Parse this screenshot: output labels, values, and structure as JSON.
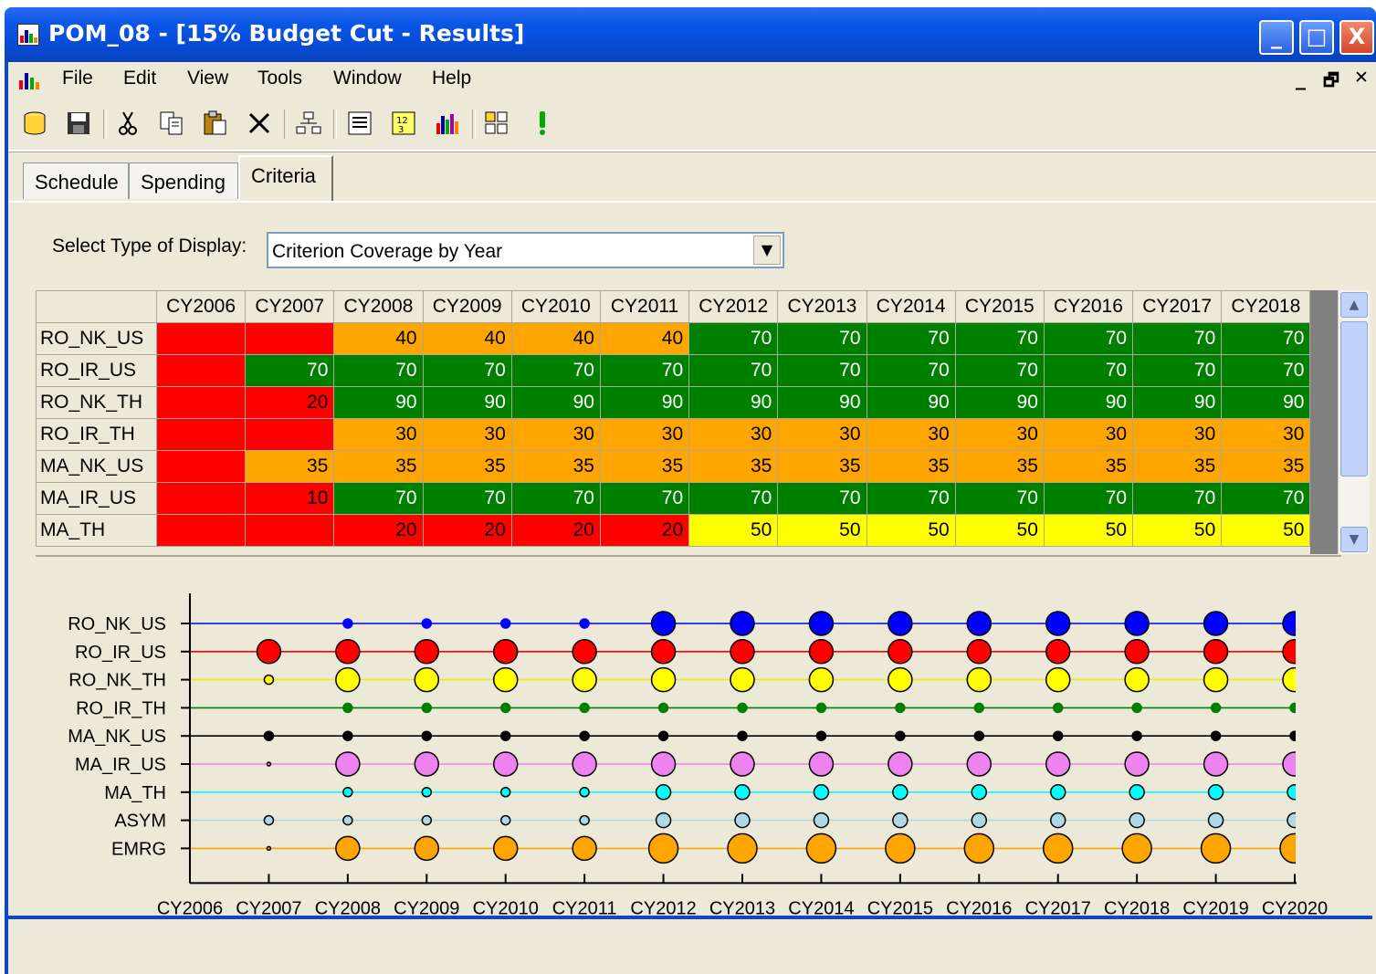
{
  "window": {
    "title": "POM_08 - [15% Budget Cut - Results]",
    "buttons": {
      "minimize": "_",
      "maximize": "□",
      "close": "X"
    }
  },
  "menu": {
    "items": [
      "File",
      "Edit",
      "View",
      "Tools",
      "Window",
      "Help"
    ],
    "mdi": {
      "minimize": "_",
      "restore": "🗗",
      "close": "✕"
    }
  },
  "toolbar": {
    "icons": [
      "database-icon",
      "save-icon",
      "cut-icon",
      "copy-icon",
      "paste-icon",
      "delete-icon",
      "hierarchy-icon",
      "list-icon",
      "table-numbers-icon",
      "bar-chart-icon",
      "layout-icon",
      "exclamation-icon"
    ]
  },
  "tabs": [
    {
      "label": "Schedule",
      "active": false
    },
    {
      "label": "Spending",
      "active": false
    },
    {
      "label": "Criteria",
      "active": true
    }
  ],
  "display_select": {
    "label": "Select Type of Display:",
    "value": "Criterion Coverage by Year"
  },
  "table": {
    "columns": [
      "",
      "CY2006",
      "CY2007",
      "CY2008",
      "CY2009",
      "CY2010",
      "CY2011",
      "CY2012",
      "CY2013",
      "CY2014",
      "CY2015",
      "CY2016",
      "CY2017",
      "CY2018"
    ],
    "rows": [
      {
        "name": "RO_NK_US",
        "values": [
          "",
          "",
          "40",
          "40",
          "40",
          "40",
          "70",
          "70",
          "70",
          "70",
          "70",
          "70",
          "70"
        ]
      },
      {
        "name": "RO_IR_US",
        "values": [
          "",
          "70",
          "70",
          "70",
          "70",
          "70",
          "70",
          "70",
          "70",
          "70",
          "70",
          "70",
          "70"
        ]
      },
      {
        "name": "RO_NK_TH",
        "values": [
          "",
          "20",
          "90",
          "90",
          "90",
          "90",
          "90",
          "90",
          "90",
          "90",
          "90",
          "90",
          "90"
        ]
      },
      {
        "name": "RO_IR_TH",
        "values": [
          "",
          "",
          "30",
          "30",
          "30",
          "30",
          "30",
          "30",
          "30",
          "30",
          "30",
          "30",
          "30"
        ]
      },
      {
        "name": "MA_NK_US",
        "values": [
          "",
          "35",
          "35",
          "35",
          "35",
          "35",
          "35",
          "35",
          "35",
          "35",
          "35",
          "35",
          "35"
        ]
      },
      {
        "name": "MA_IR_US",
        "values": [
          "",
          "10",
          "70",
          "70",
          "70",
          "70",
          "70",
          "70",
          "70",
          "70",
          "70",
          "70",
          "70"
        ]
      },
      {
        "name": "MA_TH",
        "values": [
          "",
          "",
          "20",
          "20",
          "20",
          "20",
          "50",
          "50",
          "50",
          "50",
          "50",
          "50",
          "50"
        ]
      }
    ],
    "colors": {
      "red": "#ff0000",
      "orange": "#ffa500",
      "green": "#008000",
      "yellow": "#ffff00"
    }
  },
  "chart_data": {
    "type": "scatter",
    "title": "",
    "xlabel": "",
    "ylabel": "",
    "x": [
      "CY2006",
      "CY2007",
      "CY2008",
      "CY2009",
      "CY2010",
      "CY2011",
      "CY2012",
      "CY2013",
      "CY2014",
      "CY2015",
      "CY2016",
      "CY2017",
      "CY2018",
      "CY2019",
      "CY2020"
    ],
    "series": [
      {
        "name": "RO_NK_US",
        "color": "#0000ff",
        "sizes": [
          0,
          0,
          1,
          1,
          1,
          1,
          3,
          3,
          3,
          3,
          3,
          3,
          3,
          3,
          3
        ]
      },
      {
        "name": "RO_IR_US",
        "color": "#ff0000",
        "sizes": [
          0,
          3,
          3,
          3,
          3,
          3,
          3,
          3,
          3,
          3,
          3,
          3,
          3,
          3,
          3
        ]
      },
      {
        "name": "RO_NK_TH",
        "color": "#ffff00",
        "sizes": [
          0,
          1,
          3,
          3,
          3,
          3,
          3,
          3,
          3,
          3,
          3,
          3,
          3,
          3,
          3
        ]
      },
      {
        "name": "RO_IR_TH",
        "color": "#008000",
        "sizes": [
          0,
          0,
          1,
          1,
          1,
          1,
          1,
          1,
          1,
          1,
          1,
          1,
          1,
          1,
          1
        ]
      },
      {
        "name": "MA_NK_US",
        "color": "#000000",
        "sizes": [
          0,
          1,
          1,
          1,
          1,
          1,
          1,
          1,
          1,
          1,
          1,
          1,
          1,
          1,
          1
        ]
      },
      {
        "name": "MA_IR_US",
        "color": "#ee82ee",
        "sizes": [
          0,
          0.3,
          3,
          3,
          3,
          3,
          3,
          3,
          3,
          3,
          3,
          3,
          3,
          3,
          3
        ]
      },
      {
        "name": "MA_TH",
        "color": "#00ffff",
        "sizes": [
          0,
          0,
          1,
          1,
          1,
          1,
          2,
          2,
          2,
          2,
          2,
          2,
          2,
          2,
          2
        ]
      },
      {
        "name": "ASYM",
        "color": "#add8e6",
        "sizes": [
          0,
          1,
          1,
          1,
          1,
          1,
          2,
          2,
          2,
          2,
          2,
          2,
          2,
          2,
          2
        ]
      },
      {
        "name": "EMRG",
        "color": "#ffa500",
        "sizes": [
          0,
          0.3,
          3,
          3,
          3,
          3,
          3.3,
          3.3,
          3.3,
          3.3,
          3.3,
          3.3,
          3.3,
          3.3,
          3.3
        ]
      }
    ],
    "grid": false,
    "legend": "none"
  }
}
